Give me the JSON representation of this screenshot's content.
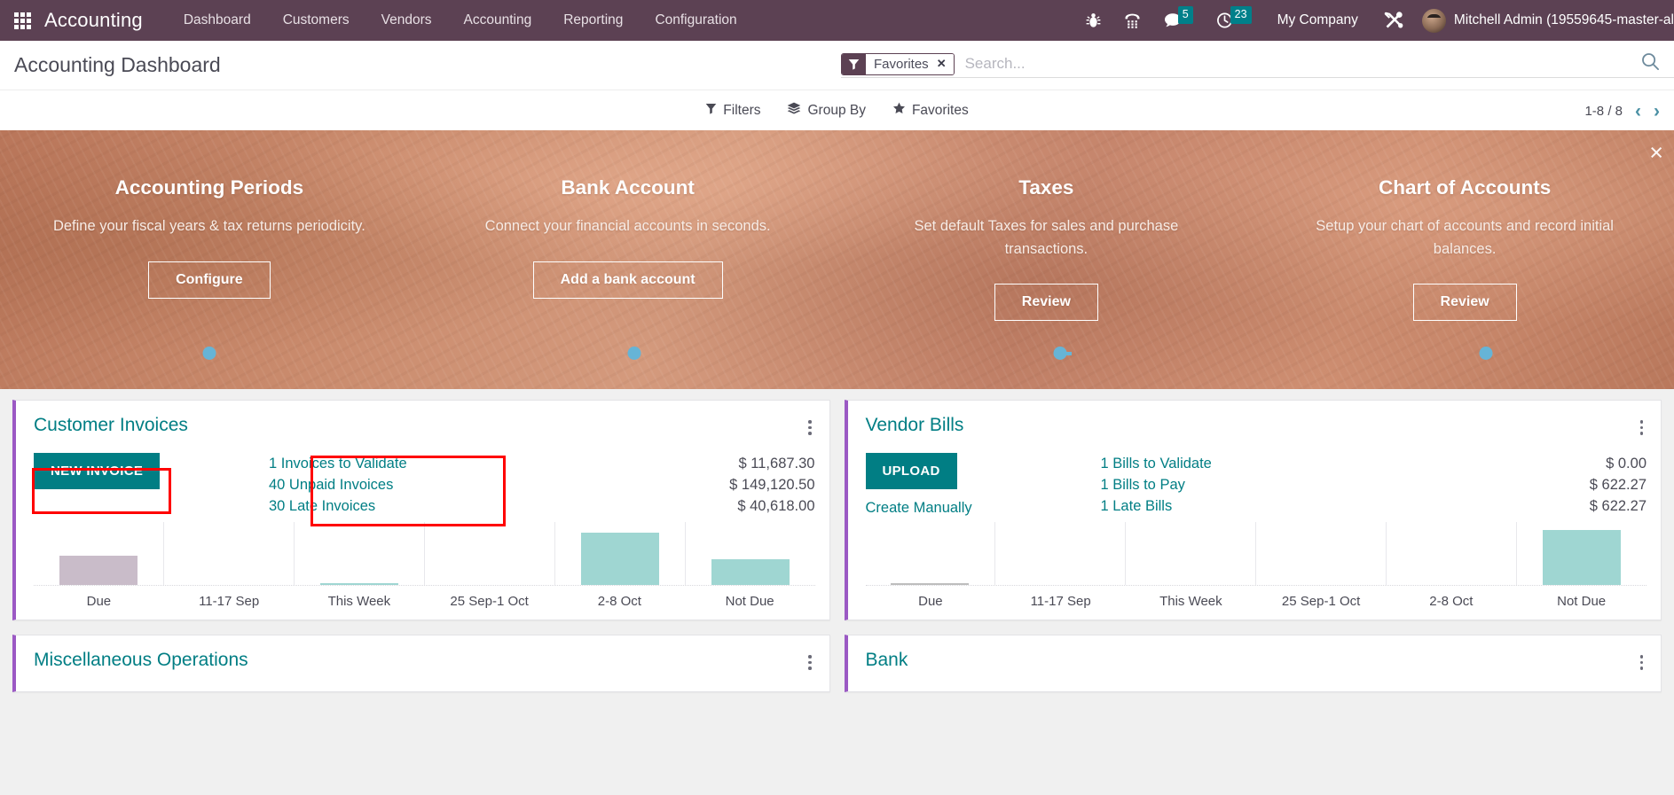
{
  "navbar": {
    "apps_icon": "grid-apps-icon",
    "brand": "Accounting",
    "menu": [
      {
        "label": "Dashboard"
      },
      {
        "label": "Customers"
      },
      {
        "label": "Vendors"
      },
      {
        "label": "Accounting"
      },
      {
        "label": "Reporting"
      },
      {
        "label": "Configuration"
      }
    ],
    "sys_icons": [
      {
        "name": "bug-icon",
        "badge": null
      },
      {
        "name": "dialpad-phone-icon",
        "badge": null
      },
      {
        "name": "chat-bubble-icon",
        "badge": "5"
      },
      {
        "name": "clock-activity-icon",
        "badge": "23"
      }
    ],
    "company": "My Company",
    "tools_icon": "tools-wrench-screwdriver-icon",
    "username": "Mitchell Admin (19559645-master-al"
  },
  "control_panel": {
    "title": "Accounting Dashboard",
    "search": {
      "facet_icon": "filter-funnel-icon",
      "facet_label": "Favorites",
      "facet_remove": "✕",
      "placeholder": "Search...",
      "value": "",
      "search_icon": "magnifier-icon"
    },
    "dropdowns": [
      {
        "label": "Filters",
        "icon": "filter-funnel-icon"
      },
      {
        "label": "Group By",
        "icon": "layers-icon"
      },
      {
        "label": "Favorites",
        "icon": "star-icon"
      }
    ],
    "pager": {
      "range": "1-8 / 8",
      "prev_icon": "chevron-left-icon",
      "next_icon": "chevron-right-icon"
    }
  },
  "banner": {
    "close_icon": "×",
    "accent_color": "#66b4d6",
    "steps": [
      {
        "title": "Accounting Periods",
        "description": "Define your fiscal years & tax returns periodicity.",
        "button": "Configure"
      },
      {
        "title": "Bank Account",
        "description": "Connect your financial accounts in seconds.",
        "button": "Add a bank account"
      },
      {
        "title": "Taxes",
        "description": "Set default Taxes for sales and purchase transactions.",
        "button": "Review"
      },
      {
        "title": "Chart of Accounts",
        "description": "Setup your chart of accounts and record initial balances.",
        "button": "Review"
      }
    ]
  },
  "cards": {
    "customer_invoices": {
      "title": "Customer Invoices",
      "primary_button": "NEW INVOICE",
      "stats": [
        {
          "label": "1 Invoices to Validate",
          "value": "$ 11,687.30"
        },
        {
          "label": "40 Unpaid Invoices",
          "value": "$ 149,120.50"
        },
        {
          "label": "30 Late Invoices",
          "value": "$ 40,618.00"
        }
      ],
      "kebab_icon": "kebab-menu-icon",
      "accent_color": "#9b59c4"
    },
    "vendor_bills": {
      "title": "Vendor Bills",
      "primary_button": "UPLOAD",
      "secondary_link": "Create Manually",
      "stats": [
        {
          "label": "1 Bills to Validate",
          "value": "$ 0.00"
        },
        {
          "label": "1 Bills to Pay",
          "value": "$ 622.27"
        },
        {
          "label": "1 Late Bills",
          "value": "$ 622.27"
        }
      ],
      "kebab_icon": "kebab-menu-icon",
      "accent_color": "#9b59c4"
    },
    "misc_operations": {
      "title": "Miscellaneous Operations",
      "kebab_icon": "kebab-menu-icon",
      "accent_color": "#9b59c4"
    },
    "bank": {
      "title": "Bank",
      "kebab_icon": "kebab-menu-icon",
      "accent_color": "#9b59c4"
    }
  },
  "chart_data": [
    {
      "type": "bar",
      "title": "Customer Invoices",
      "categories": [
        "Due",
        "11-17 Sep",
        "This Week",
        "25 Sep-1 Oct",
        "2-8 Oct",
        "Not Due"
      ],
      "values": [
        34,
        0,
        2,
        0,
        60,
        30
      ],
      "colors": [
        "#c9bcc9",
        "#9fd6d2",
        "#9fd6d2",
        "#9fd6d2",
        "#9fd6d2",
        "#9fd6d2"
      ],
      "xlabel": "",
      "ylabel": "",
      "ylim": [
        0,
        72
      ],
      "grid": false,
      "legend": "none"
    },
    {
      "type": "bar",
      "title": "Vendor Bills",
      "categories": [
        "Due",
        "11-17 Sep",
        "This Week",
        "25 Sep-1 Oct",
        "2-8 Oct",
        "Not Due"
      ],
      "values": [
        2,
        0,
        0,
        0,
        0,
        63
      ],
      "colors": [
        "#bdbdbd",
        "#9fd6d2",
        "#9fd6d2",
        "#9fd6d2",
        "#9fd6d2",
        "#9fd6d2"
      ],
      "xlabel": "",
      "ylabel": "",
      "ylim": [
        0,
        72
      ],
      "grid": false,
      "legend": "none"
    }
  ]
}
